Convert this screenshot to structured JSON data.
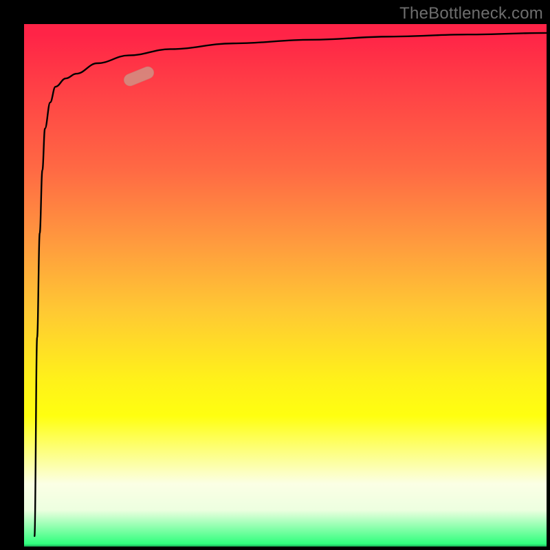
{
  "watermark": "TheBottleneck.com",
  "chart_data": {
    "type": "line",
    "title": "",
    "xlabel": "",
    "ylabel": "",
    "xlim": [
      0,
      100
    ],
    "ylim": [
      0,
      100
    ],
    "grid": false,
    "legend": false,
    "series": [
      {
        "name": "curve",
        "x": [
          2.0,
          2.5,
          3.0,
          3.5,
          4.0,
          5.0,
          6.0,
          8.0,
          10.0,
          14.0,
          20.0,
          28.0,
          40.0,
          55.0,
          70.0,
          85.0,
          100.0
        ],
        "values": [
          2.0,
          40.0,
          60.0,
          72.0,
          80.0,
          85.0,
          88.0,
          89.6,
          90.5,
          92.5,
          94.0,
          95.2,
          96.3,
          97.0,
          97.6,
          98.0,
          98.3
        ]
      }
    ],
    "background_gradient": {
      "direction": "top-to-bottom",
      "stops": [
        {
          "pos": 0.0,
          "color": "#ff2447"
        },
        {
          "pos": 0.28,
          "color": "#ff6a44"
        },
        {
          "pos": 0.55,
          "color": "#ffc933"
        },
        {
          "pos": 0.75,
          "color": "#ffff10"
        },
        {
          "pos": 0.93,
          "color": "#edffe0"
        },
        {
          "pos": 1.0,
          "color": "#1BA856"
        }
      ]
    },
    "marker": {
      "x": 22,
      "y": 90,
      "color": "#d39084",
      "shape": "rounded-pill"
    }
  }
}
